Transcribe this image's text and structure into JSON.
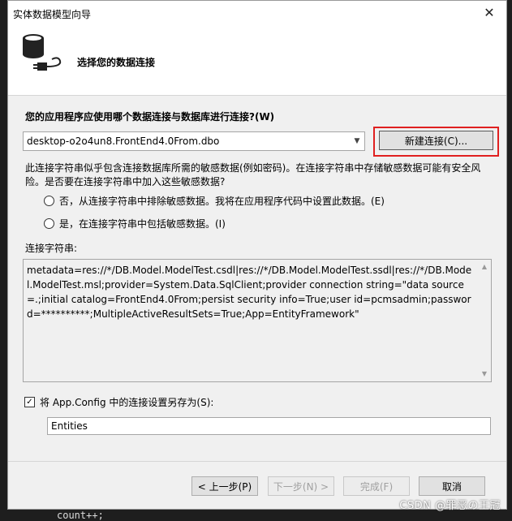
{
  "background": {
    "code_line": "count++;"
  },
  "watermark": "CSDN @罪恶の王冠",
  "dialog": {
    "title": "实体数据模型向导",
    "close_glyph": "✕",
    "header_text": "选择您的数据连接",
    "question": "您的应用程序应使用哪个数据连接与数据库进行连接?(W)",
    "connection_value": "desktop-o2o4un8.FrontEnd4.0From.dbo",
    "new_connection_label": "新建连接(C)...",
    "warning": "此连接字符串似乎包含连接数据库所需的敏感数据(例如密码)。在连接字符串中存储敏感数据可能有安全风险。是否要在连接字符串中加入这些敏感数据?",
    "option_no": "否，从连接字符串中排除敏感数据。我将在应用程序代码中设置此数据。(E)",
    "option_yes": "是，在连接字符串中包括敏感数据。(I)",
    "connection_string_label": "连接字符串:",
    "connection_string": "metadata=res://*/DB.Model.ModelTest.csdl|res://*/DB.Model.ModelTest.ssdl|res://*/DB.Model.ModelTest.msl;provider=System.Data.SqlClient;provider connection string=\"data source=.;initial catalog=FrontEnd4.0From;persist security info=True;user id=pcmsadmin;password=**********;MultipleActiveResultSets=True;App=EntityFramework\"",
    "save_checkbox_label": "将 App.Config 中的连接设置另存为(S):",
    "save_checked": true,
    "entity_name": "Entities",
    "buttons": {
      "prev": "< 上一步(P)",
      "next": "下一步(N) >",
      "finish": "完成(F)",
      "cancel": "取消"
    }
  },
  "colors": {
    "highlight": "#e02020",
    "dialog_bg": "#f0f0f0",
    "ide_bg": "#1e1e1e"
  }
}
